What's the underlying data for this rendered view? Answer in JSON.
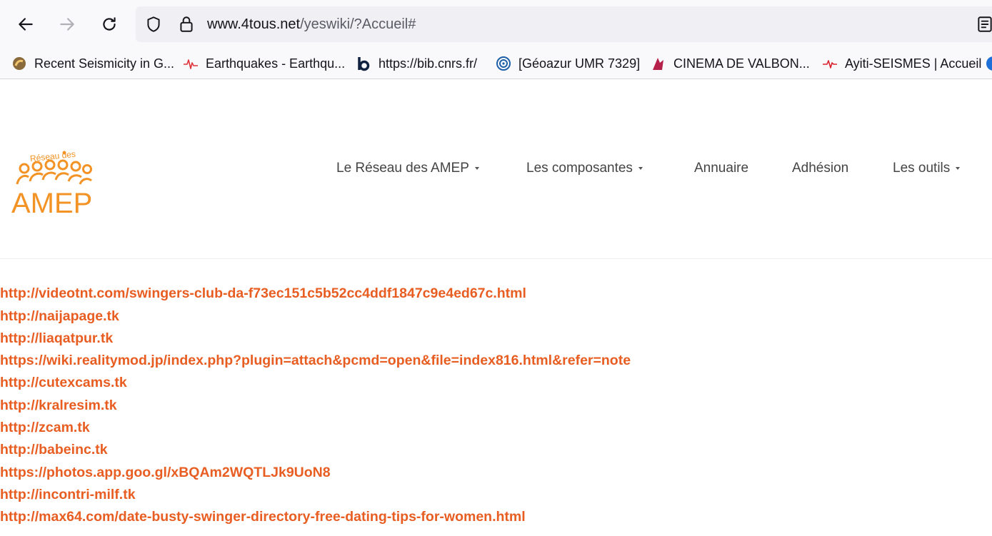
{
  "browser": {
    "url_host": "www.4tous.net",
    "url_path": "/yeswiki/?Accueil#",
    "bookmarks": [
      {
        "label": "Recent Seismicity in G...",
        "icon": "seismicity-icon"
      },
      {
        "label": "Earthquakes - Earthqu...",
        "icon": "earthquake-wave-icon"
      },
      {
        "label": "https://bib.cnrs.fr/",
        "icon": "bib-b-icon"
      },
      {
        "label": "[Géoazur UMR 7329]",
        "icon": "geoazur-icon"
      },
      {
        "label": "CINEMA DE VALBON...",
        "icon": "cinema-icon"
      },
      {
        "label": "Ayiti-SEISMES | Accueil",
        "icon": "seismes-wave-icon"
      }
    ]
  },
  "site": {
    "logo_top_text": "Réseau des",
    "logo_main_text": "AMEP",
    "brand_color": "#f39325",
    "link_color": "#e85d22",
    "menu": [
      {
        "label": "Le Réseau des AMEP",
        "dropdown": true
      },
      {
        "label": "Les composantes",
        "dropdown": true
      },
      {
        "label": "Annuaire",
        "dropdown": false
      },
      {
        "label": "Adhésion",
        "dropdown": false
      },
      {
        "label": "Les outils",
        "dropdown": true
      }
    ]
  },
  "content": {
    "links": [
      "http://videotnt.com/swingers-club-da-f73ec151c5b52cc4ddf1847c9e4ed67c.html",
      "http://naijapage.tk",
      "http://liaqatpur.tk",
      "https://wiki.realitymod.jp/index.php?plugin=attach&pcmd=open&file=index816.html&refer=note",
      "http://cutexcams.tk",
      "http://kralresim.tk",
      "http://zcam.tk",
      "http://babeinc.tk",
      "https://photos.app.goo.gl/xBQAm2WQTLJk9UoN8",
      "http://incontri-milf.tk",
      "http://max64.com/date-busty-swinger-directory-free-dating-tips-for-women.html"
    ]
  }
}
